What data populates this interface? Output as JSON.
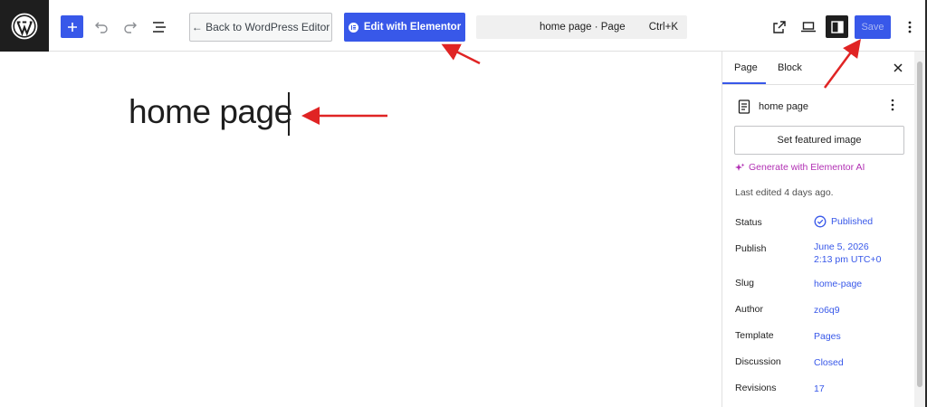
{
  "toolbar": {
    "back_label": "← Back to WordPress Editor",
    "elementor_label": "Edit with Elementor",
    "command_title": "home page · Page",
    "command_shortcut": "Ctrl+K",
    "save_label": "Save"
  },
  "editor": {
    "page_title": "home page"
  },
  "sidebar": {
    "tabs": [
      {
        "label": "Page"
      },
      {
        "label": "Block"
      }
    ],
    "document_title": "home page",
    "featured_image_label": "Set featured image",
    "generate_ai_label": "Generate with Elementor AI",
    "last_edited": "Last edited 4 days ago.",
    "meta": [
      {
        "label": "Status",
        "value": "Published"
      },
      {
        "label": "Publish",
        "value": "June 5, 2026",
        "value2": "2:13 pm UTC+0"
      },
      {
        "label": "Slug",
        "value": "home-page"
      },
      {
        "label": "Author",
        "value": "zo6q9"
      },
      {
        "label": "Template",
        "value": "Pages"
      },
      {
        "label": "Discussion",
        "value": "Closed"
      },
      {
        "label": "Revisions",
        "value": "17"
      }
    ]
  },
  "colors": {
    "accent": "#3858e9",
    "ai_purple": "#b12fb3",
    "annotation_red": "#e02424"
  }
}
